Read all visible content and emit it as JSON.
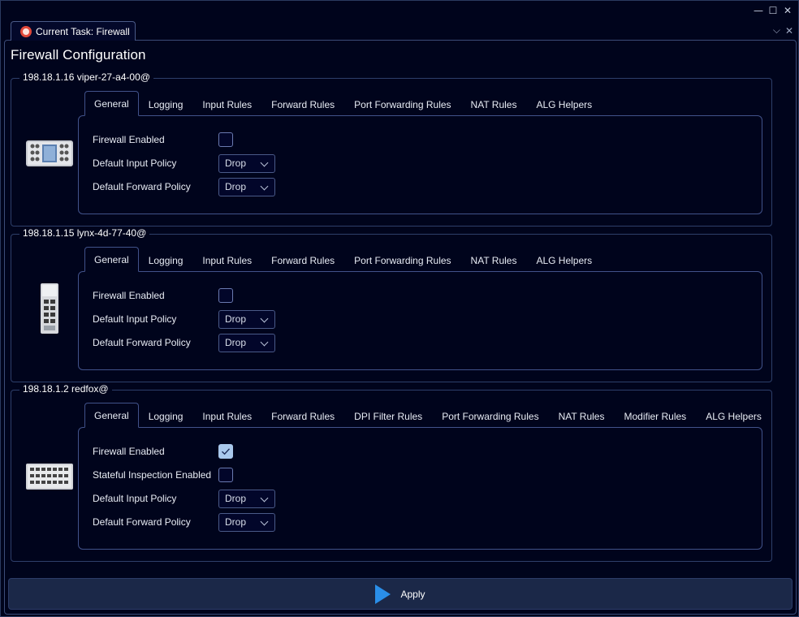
{
  "window": {
    "minimize_glyph": "—",
    "maximize_glyph": "☐",
    "close_glyph": "✕"
  },
  "doc_tab": {
    "label": "Current Task: Firewall",
    "icon": "task-icon"
  },
  "tabstrip": {
    "dropdown_glyph": "⌵",
    "close_glyph": "✕"
  },
  "page_title": "Firewall Configuration",
  "devices": [
    {
      "title": "198.18.1.16 viper-27-a4-00@",
      "tabs": [
        "General",
        "Logging",
        "Input Rules",
        "Forward Rules",
        "Port Forwarding Rules",
        "NAT Rules",
        "ALG Helpers"
      ],
      "active_tab": "General",
      "fields": [
        {
          "label": "Firewall Enabled",
          "type": "checkbox",
          "checked": false
        },
        {
          "label": "Default Input Policy",
          "type": "select",
          "value": "Drop"
        },
        {
          "label": "Default Forward Policy",
          "type": "select",
          "value": "Drop"
        }
      ]
    },
    {
      "title": "198.18.1.15 lynx-4d-77-40@",
      "tabs": [
        "General",
        "Logging",
        "Input Rules",
        "Forward Rules",
        "Port Forwarding Rules",
        "NAT Rules",
        "ALG Helpers"
      ],
      "active_tab": "General",
      "fields": [
        {
          "label": "Firewall Enabled",
          "type": "checkbox",
          "checked": false
        },
        {
          "label": "Default Input Policy",
          "type": "select",
          "value": "Drop"
        },
        {
          "label": "Default Forward Policy",
          "type": "select",
          "value": "Drop"
        }
      ]
    },
    {
      "title": "198.18.1.2 redfox@",
      "tabs": [
        "General",
        "Logging",
        "Input Rules",
        "Forward Rules",
        "DPI Filter Rules",
        "Port Forwarding Rules",
        "NAT Rules",
        "Modifier Rules",
        "ALG Helpers"
      ],
      "active_tab": "General",
      "fields": [
        {
          "label": "Firewall Enabled",
          "type": "checkbox",
          "checked": true
        },
        {
          "label": "Stateful Inspection Enabled",
          "type": "checkbox",
          "checked": false
        },
        {
          "label": "Default Input Policy",
          "type": "select",
          "value": "Drop"
        },
        {
          "label": "Default Forward Policy",
          "type": "select",
          "value": "Drop"
        }
      ]
    }
  ],
  "apply": {
    "label": "Apply",
    "icon": "play-icon",
    "icon_color": "#2a8ee8"
  },
  "colors": {
    "background": "#00041c",
    "border": "#41528a",
    "checked_fill": "#a9c8ec"
  }
}
